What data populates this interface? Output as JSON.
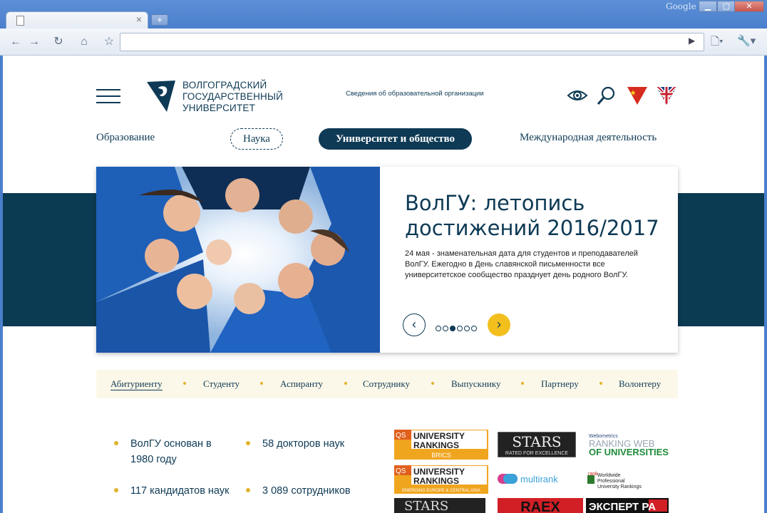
{
  "browser": {
    "brand_label": "Google",
    "window_buttons": [
      "minimize",
      "maximize",
      "close"
    ],
    "new_tab_label": "+",
    "url": ""
  },
  "header": {
    "logo_lines": [
      "ВОЛГОГРАДСКИЙ",
      "ГОСУДАРСТВЕННЫЙ",
      "УНИВЕРСИТЕТ"
    ],
    "org_info": "Сведения об образовательной организации",
    "icons": [
      "eye-icon",
      "search-icon",
      "china-flag-icon",
      "uk-flag-icon"
    ]
  },
  "nav": {
    "items": [
      "Образование",
      "Наука",
      "Университет и общество",
      "Международная деятельность"
    ]
  },
  "slider": {
    "title": "ВолГУ: летопись достижений 2016/2017",
    "text": "24 мая - знаменательная дата для студентов и преподавателей ВолГУ. Ежегодно в День славянской письменности все университетское сообщество празднует день родного ВолГУ.",
    "slide_count": 6,
    "active_slide": 3
  },
  "audience": {
    "items": [
      "Абитуриенту",
      "Студенту",
      "Аспиранту",
      "Сотруднику",
      "Выпускнику",
      "Партнеру",
      "Волонтеру"
    ]
  },
  "facts": [
    "ВолГУ основан в 1980 году",
    "58 докторов наук",
    "117 кандидатов наук",
    "3 089 сотрудников"
  ],
  "rankings": {
    "qs_brics": [
      "UNIVERSITY",
      "RANKINGS",
      "BRICS"
    ],
    "qs_eeca": [
      "UNIVERSITY",
      "RANKINGS",
      "EMERGING EUROPE & CENTRAL ASIA"
    ],
    "stars": [
      "STARS",
      "RATED FOR EXCELLENCE"
    ],
    "webometrics": [
      "Webometrics",
      "RANKING WEB",
      "OF UNIVERSITIES"
    ],
    "multirank": "multirank",
    "rankpro": [
      "rank",
      "Worldwide",
      "Professional",
      "University Rankings"
    ],
    "raex": "RAEX",
    "expert": "ЭКСПЕРТ РА"
  },
  "colors": {
    "primary": "#0e3a55",
    "accent": "#f2bf1d",
    "band": "#0b3a53",
    "audience_bg": "#fcf8e9"
  }
}
